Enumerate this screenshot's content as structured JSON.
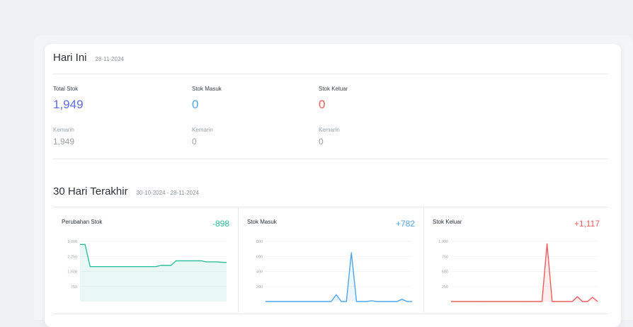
{
  "today": {
    "title": "Hari Ini",
    "date": "28-11-2024",
    "stats": [
      {
        "label": "Total Stok",
        "value": "1,949",
        "sub_label": "Kemarin",
        "sub_value": "1,949"
      },
      {
        "label": "Stok Masuk",
        "value": "0",
        "sub_label": "Kemarin",
        "sub_value": "0"
      },
      {
        "label": "Stok Keluar",
        "value": "0",
        "sub_label": "Kemarin",
        "sub_value": "0"
      }
    ]
  },
  "last30": {
    "title": "30 Hari Terakhir",
    "date_range": "30-10-2024 - 28-11-2024"
  },
  "colors": {
    "total": "#5a6ee0",
    "masuk": "#4ea6e6",
    "keluar": "#ef5b5b",
    "perubahan": "#2fbf9a"
  },
  "chart_data": [
    {
      "type": "area",
      "title": "Perubahan Stok",
      "summary": "-898",
      "yticks": [
        "3,000",
        "2,250",
        "1,500",
        "750"
      ],
      "ylim": [
        0,
        3000
      ],
      "values": [
        2847,
        2847,
        1740,
        1740,
        1740,
        1740,
        1740,
        1740,
        1740,
        1740,
        1740,
        1740,
        1740,
        1740,
        1740,
        1740,
        1800,
        1800,
        1800,
        2030,
        2030,
        2030,
        2030,
        2030,
        2030,
        1980,
        1980,
        1980,
        1960,
        1949
      ]
    },
    {
      "type": "area",
      "title": "Stok Masuk",
      "summary": "+782",
      "yticks": [
        "800",
        "600",
        "400",
        "200"
      ],
      "ylim": [
        0,
        800
      ],
      "values": [
        0,
        0,
        0,
        0,
        0,
        0,
        0,
        0,
        0,
        0,
        0,
        0,
        0,
        0,
        90,
        0,
        0,
        650,
        0,
        0,
        0,
        10,
        0,
        0,
        0,
        0,
        0,
        30,
        0,
        0
      ]
    },
    {
      "type": "area",
      "title": "Stok Keluar",
      "summary": "+1,117",
      "yticks": [
        "1,000",
        "750",
        "500",
        "250"
      ],
      "ylim": [
        0,
        1000
      ],
      "values": [
        0,
        0,
        0,
        0,
        0,
        0,
        0,
        0,
        0,
        0,
        0,
        0,
        0,
        0,
        0,
        0,
        0,
        0,
        0,
        960,
        0,
        0,
        0,
        0,
        0,
        80,
        0,
        0,
        70,
        0
      ]
    }
  ]
}
